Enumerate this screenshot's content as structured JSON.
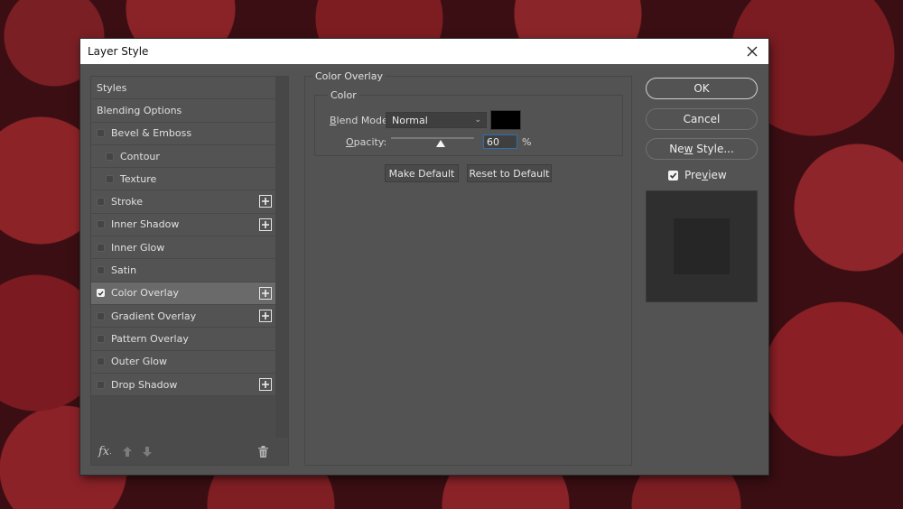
{
  "dialog": {
    "title": "Layer Style",
    "close_icon": "close-icon"
  },
  "styles_panel": {
    "items": [
      {
        "label": "Styles",
        "type": "header",
        "checkbox": false,
        "checked": false,
        "add": false,
        "selected": false
      },
      {
        "label": "Blending Options",
        "type": "header",
        "checkbox": false,
        "checked": false,
        "add": false,
        "selected": false
      },
      {
        "label": "Bevel & Emboss",
        "type": "item",
        "checkbox": true,
        "checked": false,
        "add": false,
        "selected": false
      },
      {
        "label": "Contour",
        "type": "sub",
        "checkbox": true,
        "checked": false,
        "add": false,
        "selected": false
      },
      {
        "label": "Texture",
        "type": "sub",
        "checkbox": true,
        "checked": false,
        "add": false,
        "selected": false
      },
      {
        "label": "Stroke",
        "type": "item",
        "checkbox": true,
        "checked": false,
        "add": true,
        "selected": false
      },
      {
        "label": "Inner Shadow",
        "type": "item",
        "checkbox": true,
        "checked": false,
        "add": true,
        "selected": false
      },
      {
        "label": "Inner Glow",
        "type": "item",
        "checkbox": true,
        "checked": false,
        "add": false,
        "selected": false
      },
      {
        "label": "Satin",
        "type": "item",
        "checkbox": true,
        "checked": false,
        "add": false,
        "selected": false
      },
      {
        "label": "Color Overlay",
        "type": "item",
        "checkbox": true,
        "checked": true,
        "add": true,
        "selected": true
      },
      {
        "label": "Gradient Overlay",
        "type": "item",
        "checkbox": true,
        "checked": false,
        "add": true,
        "selected": false
      },
      {
        "label": "Pattern Overlay",
        "type": "item",
        "checkbox": true,
        "checked": false,
        "add": false,
        "selected": false
      },
      {
        "label": "Outer Glow",
        "type": "item",
        "checkbox": true,
        "checked": false,
        "add": false,
        "selected": false
      },
      {
        "label": "Drop Shadow",
        "type": "item",
        "checkbox": true,
        "checked": false,
        "add": true,
        "selected": false
      }
    ],
    "footer": {
      "fx_label": "fx",
      "icons": [
        "fx-icon",
        "move-up-icon",
        "move-down-icon",
        "trash-icon"
      ]
    }
  },
  "color_overlay": {
    "section_title": "Color Overlay",
    "group_title": "Color",
    "blend_mode_label": "Blend Mode:",
    "blend_mode_value": "Normal",
    "overlay_color": "#000000",
    "opacity_label": "Opacity:",
    "opacity_value": "60",
    "opacity_unit": "%",
    "opacity_percent": 60,
    "make_default_label": "Make Default",
    "reset_default_label": "Reset to Default"
  },
  "actions": {
    "ok_label": "OK",
    "cancel_label": "Cancel",
    "new_style_label": "New Style...",
    "preview_label": "Preview",
    "preview_checked": true
  }
}
